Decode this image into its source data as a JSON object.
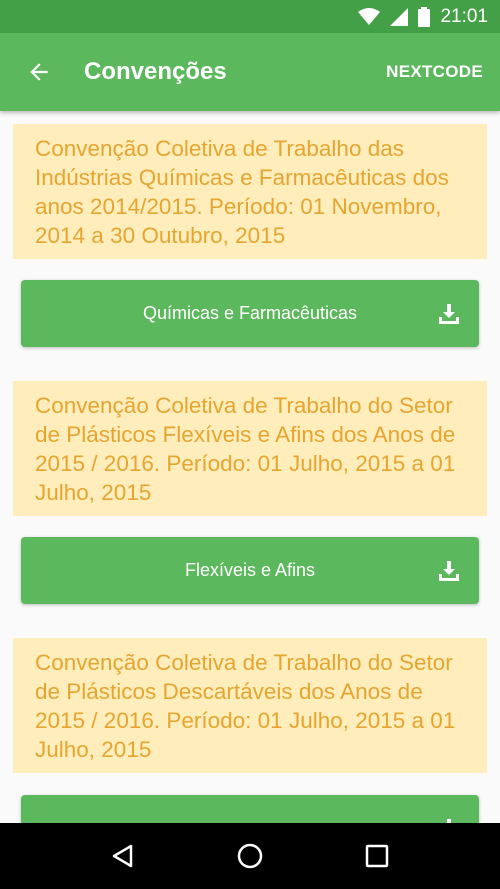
{
  "status_bar": {
    "time": "21:01",
    "icons": [
      "wifi-icon",
      "signal-icon",
      "battery-icon"
    ]
  },
  "app_bar": {
    "back_icon": "arrow-back-icon",
    "title": "Convenções",
    "action_label": "NEXTCODE"
  },
  "conventions": [
    {
      "description": "Convenção Coletiva de Trabalho das Indústrias Químicas e Farmacêuticas dos anos 2014/2015. Período: 01 Novembro, 2014 a 30 Outubro, 2015",
      "button_label": "Químicas e Farmacêuticas",
      "button_icon": "download-icon"
    },
    {
      "description": "Convenção Coletiva de Trabalho do Setor de Plásticos Flexíveis e Afins dos Anos de 2015 / 2016. Período: 01 Julho, 2015 a 01 Julho, 2015",
      "button_label": "Flexíveis e Afins",
      "button_icon": "download-icon"
    },
    {
      "description": "Convenção Coletiva de Trabalho do Setor de Plásticos Descartáveis dos Anos de 2015 / 2016. Período: 01 Julho, 2015 a 01 Julho, 2015",
      "button_icon": "download-icon"
    }
  ],
  "nav_bar": {
    "icons": [
      "back-triangle-icon",
      "home-circle-icon",
      "recents-square-icon"
    ]
  },
  "colors": {
    "status_bar": "#43a047",
    "primary": "#5cb85c",
    "card_background": "#ffeebb",
    "card_text": "#e6a531",
    "background": "#fafafa"
  }
}
